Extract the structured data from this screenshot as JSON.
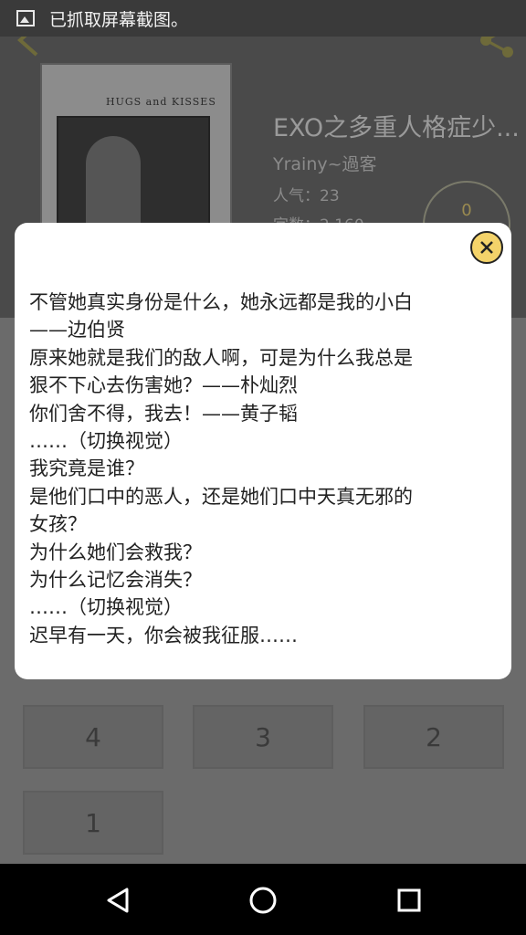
{
  "status_bar": {
    "notification_icon": "image-icon",
    "text": "已抓取屏幕截图。"
  },
  "app": {
    "back_icon": "back-arrow-icon",
    "share_icon": "share-icon",
    "cover_text": "HUGS and KISSES",
    "book": {
      "title": "EXO之多重人格症少...",
      "author": "Yrainy~過客",
      "popularity": "人气：23",
      "words": "字数：2,160",
      "count": "0"
    },
    "chapters": [
      "4",
      "3",
      "2",
      "1"
    ]
  },
  "dialog": {
    "close_icon": "close-circle-icon",
    "lines": [
      "不管她真实身份是什么，她永远都是我的小白",
      "——边伯贤",
      "原来她就是我们的敌人啊，可是为什么我总是",
      "狠不下心去伤害她？——朴灿烈",
      "你们舍不得，我去！——黄子韬",
      "……（切换视觉）",
      "我究竟是谁？",
      "是他们口中的恶人，还是她们口中天真无邪的",
      "女孩？",
      "为什么她们会救我？",
      "为什么记忆会消失？",
      "……（切换视觉）",
      "迟早有一天，你会被我征服……"
    ]
  },
  "nav": {
    "back": "back-triangle-icon",
    "home": "home-circle-icon",
    "recents": "recents-square-icon"
  }
}
